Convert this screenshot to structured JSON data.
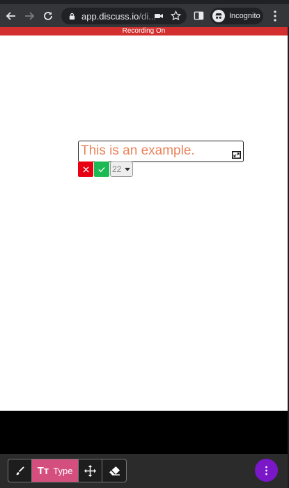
{
  "browser": {
    "url_host": "app.discuss.io",
    "url_path": "/di...",
    "incognito_label": "Incognito"
  },
  "banner": {
    "text": "Recording On",
    "color": "#d32f2f"
  },
  "editor": {
    "text_value": "This is an example.",
    "text_color": "#e8845c",
    "font_size_value": "22"
  },
  "toolbar": {
    "type_label": "Type",
    "type_glyph": "Tт",
    "active_color": "#d54f7e"
  },
  "fab": {
    "color": "#7a18c9"
  }
}
